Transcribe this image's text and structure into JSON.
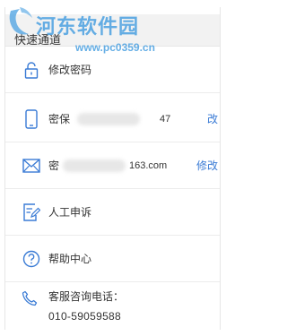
{
  "header": {
    "title": "快速通道"
  },
  "rows": [
    {
      "label": "修改密码"
    },
    {
      "label": "密保",
      "masked": "47",
      "action": "改"
    },
    {
      "label": "密",
      "masked": "163.com",
      "action": "修改"
    },
    {
      "label": "人工申诉"
    },
    {
      "label": "帮助中心"
    }
  ],
  "hotline": {
    "label": "客服咨询电话：",
    "number": "010-59059588"
  },
  "watermark": {
    "title": "河东软件园",
    "url": "www.pc0359.cn"
  },
  "colors": {
    "accent": "#3a7bd5",
    "watermark": "#4aa0e1"
  }
}
